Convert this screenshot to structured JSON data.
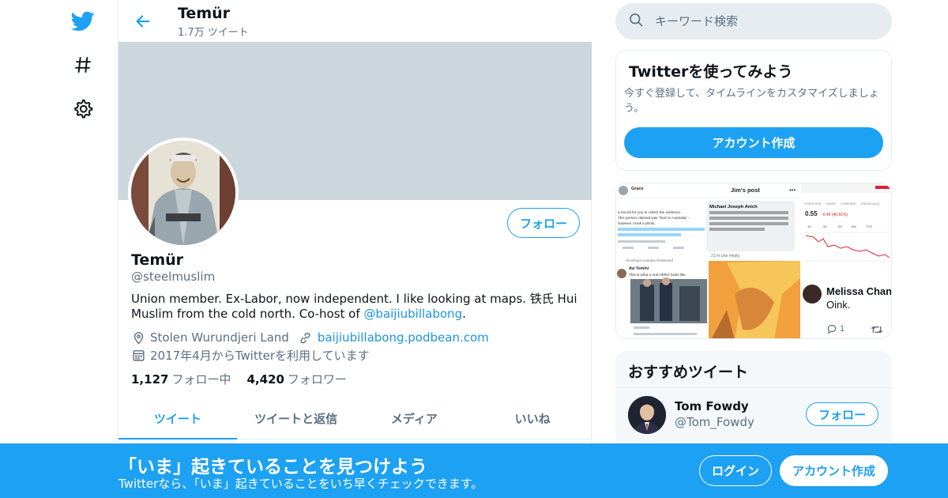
{
  "nav": {
    "icons": [
      "twitter-bird-icon",
      "hashtag-icon",
      "gear-icon"
    ]
  },
  "header": {
    "name": "Temür",
    "tweet_count": "1.7万 ツイート"
  },
  "profile": {
    "name": "Temür",
    "handle": "@steelmuslim",
    "follow_label": "フォロー",
    "bio_text": "Union member. Ex-Labor, now independent. I like looking at maps. 铁氏 Hui Muslim from the cold north. Co-host of ",
    "bio_link": "@baijiubillabong",
    "bio_end": ".",
    "location": "Stolen Wurundjeri Land",
    "website": "baijiubillabong.podbean.com",
    "joined": "2017年4月からTwitterを利用しています",
    "following_count": "1,127",
    "following_label": "フォロー中",
    "followers_count": "4,420",
    "followers_label": "フォロワー"
  },
  "tabs": [
    {
      "label": "ツイート",
      "active": true
    },
    {
      "label": "ツイートと返信",
      "active": false
    },
    {
      "label": "メディア",
      "active": false
    },
    {
      "label": "いいね",
      "active": false
    }
  ],
  "search": {
    "placeholder": "キーワード検索"
  },
  "try_card": {
    "title": "Twitterを使ってみよう",
    "description": "今すぐ登録して、タイムラインをカスタマイズしましょう。",
    "button": "アカウント作成"
  },
  "media": {
    "tweet_card": {
      "user": "Grace",
      "header": "Jim's post",
      "line1": "a record for you to collect the evidence.",
      "line2": "This person claimed was \"born in Australia\" -",
      "line3": "however I took a photo.",
      "reply_user": "Michael Joseph Anich",
      "reply_text": "Heaps of Aussies live off grid in South East Asia with beautiful young wives. They learn from. Us and we learn from them",
      "reply_actions": "21 m   Like   Reply",
      "retweeted_by": "Hiroshaya Australia Retweeted",
      "quote_user": "Avi Yemini",
      "quote_text": "This is what a real HERO looks like."
    },
    "stock_card": {
      "value": "0.55",
      "change": "-0.45 (40.81%)",
      "tabs": [
        "OVERVIEW",
        "NEWS",
        "COMPARE",
        "FINANCIALS"
      ],
      "ranges": [
        "1D",
        "5D",
        "1M",
        "6M",
        "YTD"
      ]
    },
    "user_tweet": {
      "name": "Melissa Chan",
      "text": "Oink.",
      "reply_count": "1"
    }
  },
  "recommended": {
    "title": "おすすめツイート",
    "user_name": "Tom Fowdy",
    "user_handle": "@Tom_Fowdy",
    "follow_label": "フォロー"
  },
  "bottom_bar": {
    "headline": "「いま」起きていることを見つけよう",
    "subtext": "Twitterなら、「いま」起きていることをいち早くチェックできます。",
    "login": "ログイン",
    "signup": "アカウント作成"
  },
  "colors": {
    "brand_blue": "#1da1f2",
    "link_blue": "#1b95e0",
    "secondary_text": "#5b7083",
    "banner_gray": "#ccd6dd"
  }
}
